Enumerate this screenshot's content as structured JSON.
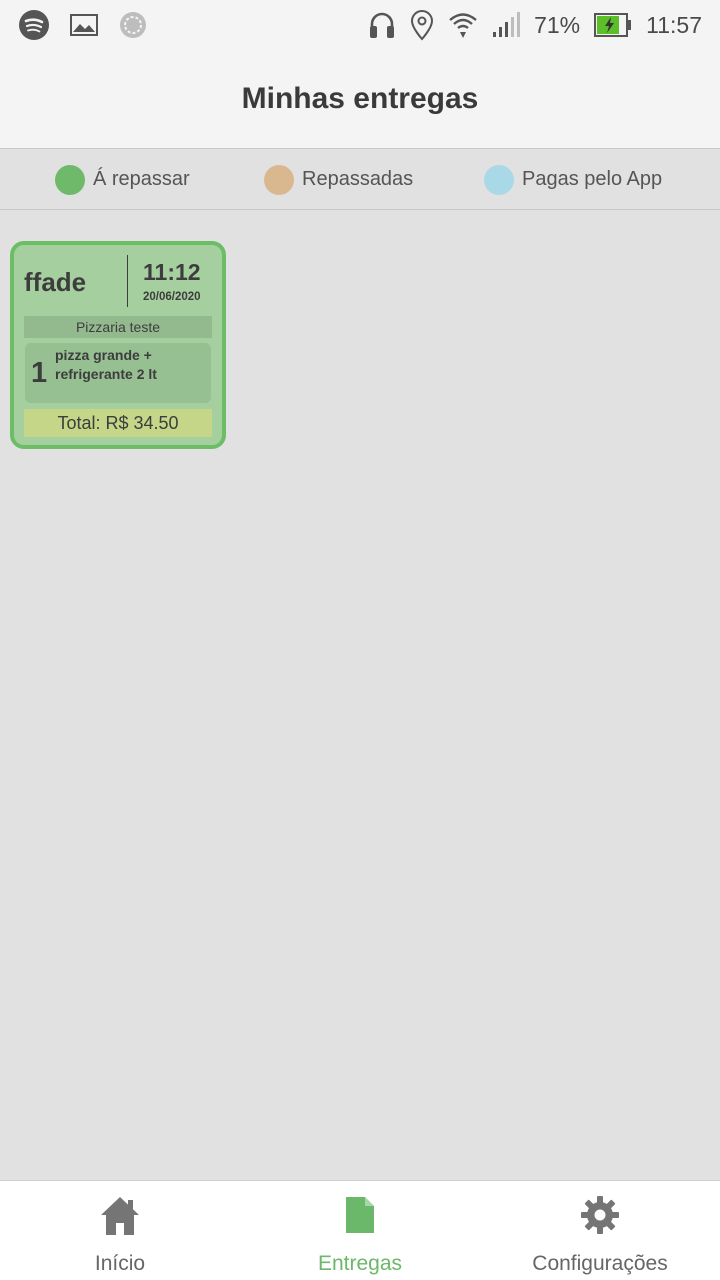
{
  "status_bar": {
    "left_icons": [
      "spotify-icon",
      "gallery-icon",
      "sync-icon"
    ],
    "right_icons": [
      "headphones-icon",
      "location-icon",
      "wifi-icon",
      "signal-icon"
    ],
    "battery": "71%",
    "time": "11:57"
  },
  "header": {
    "title": "Minhas entregas"
  },
  "legend": {
    "items": [
      {
        "label": "Á repassar",
        "color": "#6fb96a"
      },
      {
        "label": "Repassadas",
        "color": "#d9b88f"
      },
      {
        "label": "Pagas pelo App",
        "color": "#a9d9e6"
      }
    ]
  },
  "deliveries": [
    {
      "name": "ffade",
      "time": "11:12",
      "date": "20/06/2020",
      "store": "Pizzaria teste",
      "items": [
        {
          "qty": "1",
          "description": "pizza grande + refrigerante 2 lt"
        }
      ],
      "total": "Total: R$ 34.50",
      "status_color": "#6fb96a"
    }
  ],
  "bottom_nav": {
    "items": [
      {
        "label": "Início",
        "icon": "home-icon",
        "active": false
      },
      {
        "label": "Entregas",
        "icon": "document-icon",
        "active": true
      },
      {
        "label": "Configurações",
        "icon": "gear-icon",
        "active": false
      }
    ],
    "active_color": "#6cb86a",
    "inactive_color": "#757575"
  }
}
